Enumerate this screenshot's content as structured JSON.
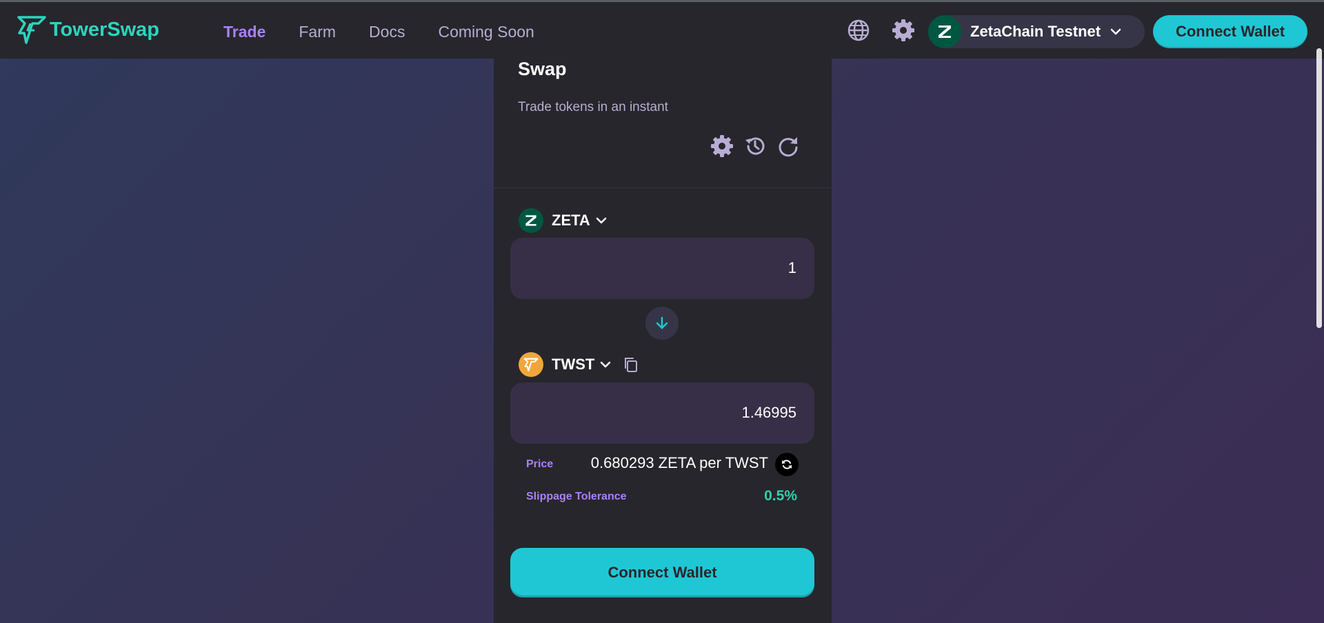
{
  "app": {
    "name": "TowerSwap",
    "accent": "#1fc7d4",
    "brand": "#2dd4bf",
    "nav_active_color": "#a881fc"
  },
  "header": {
    "nav": [
      {
        "label": "Trade",
        "active": true
      },
      {
        "label": "Farm",
        "active": false
      },
      {
        "label": "Docs",
        "active": false
      },
      {
        "label": "Coming Soon",
        "active": false
      }
    ],
    "language_icon": "globe-icon",
    "settings_icon": "gear-icon",
    "network": {
      "label": "ZetaChain Testnet",
      "icon": "zetachain-logo"
    },
    "connect_label": "Connect Wallet"
  },
  "swap": {
    "title": "Swap",
    "subtitle": "Trade tokens in an instant",
    "icons": [
      "gear-icon",
      "history-icon",
      "refresh-icon"
    ],
    "from": {
      "symbol": "ZETA",
      "amount": "1"
    },
    "to": {
      "symbol": "TWST",
      "amount": "1.46995"
    },
    "switch_icon": "arrow-down-icon",
    "price_label": "Price",
    "price_value": "0.680293 ZETA per TWST",
    "slippage_label": "Slippage Tolerance",
    "slippage_value": "0.5%",
    "connect_label": "Connect Wallet"
  }
}
